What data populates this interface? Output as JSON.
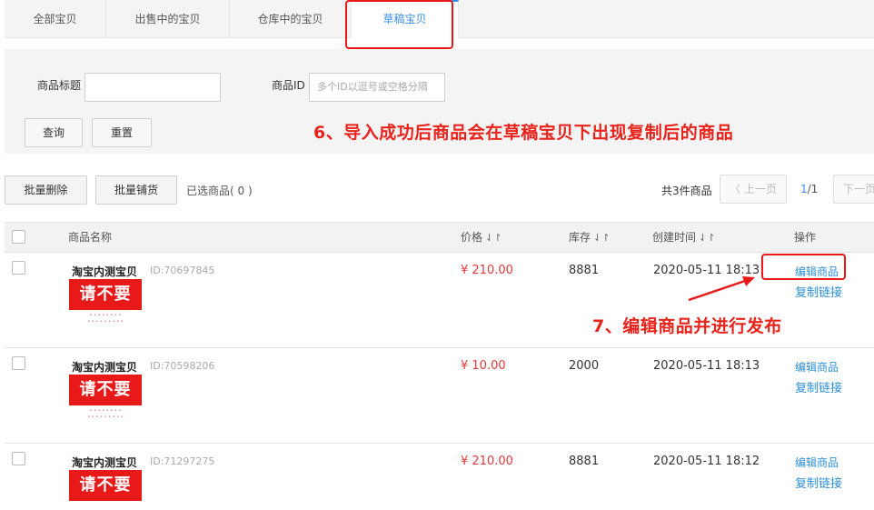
{
  "tabs": [
    {
      "label": "全部宝贝"
    },
    {
      "label": "出售中的宝贝"
    },
    {
      "label": "仓库中的宝贝"
    },
    {
      "label": "草稿宝贝"
    }
  ],
  "filter": {
    "title_label": "商品标题",
    "title_value": "",
    "id_label": "商品ID",
    "id_placeholder": "多个ID以逗号或空格分隔",
    "query_button": "查询",
    "reset_button": "重置"
  },
  "annotations": {
    "step6": "6、导入成功后商品会在草稿宝贝下出现复制后的商品",
    "step7": "7、编辑商品并进行发布"
  },
  "toolbar": {
    "batch_delete": "批量删除",
    "batch_list": "批量铺货",
    "selected_text": "已选商品(  0  )",
    "total_text": "共3件商品",
    "prev_page": "上一页",
    "page_current": "1",
    "page_total": "/1",
    "next_page": "下一页"
  },
  "table": {
    "headers": {
      "name": "商品名称",
      "price": "价格",
      "stock": "库存",
      "created": "创建时间",
      "action": "操作"
    },
    "sort_icon": "⇃↾",
    "rows": [
      {
        "name": "淘宝内测宝贝",
        "id": "ID:70697845",
        "thumb_text": "请不要拍!",
        "price": "¥ 210.00",
        "stock": "8881",
        "created": "2020-05-11 18:13",
        "edit": "编辑商品",
        "copy": "复制链接"
      },
      {
        "name": "淘宝内测宝贝",
        "id": "ID:70598206",
        "thumb_text": "请不要拍!",
        "price": "¥ 10.00",
        "stock": "2000",
        "created": "2020-05-11 18:13",
        "edit": "编辑商品",
        "copy": "复制链接"
      },
      {
        "name": "淘宝内测宝贝",
        "id": "ID:71297275",
        "thumb_text": "请不要拍!",
        "price": "¥ 210.00",
        "stock": "8881",
        "created": "2020-05-11 18:12",
        "edit": "编辑商品",
        "copy": "复制链接"
      }
    ]
  },
  "colors": {
    "accent": "#3a8ee6",
    "annotation_red": "#e8231b",
    "price_red": "#e4393c",
    "link_blue": "#2d8fd5"
  }
}
